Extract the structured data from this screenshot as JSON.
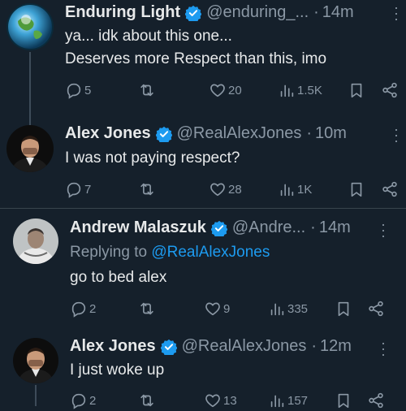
{
  "tweets": [
    {
      "name": "Enduring Light",
      "handle": "@enduring_...",
      "time": "14m",
      "lines": [
        "ya... idk about this one...",
        "Deserves more Respect than this, imo"
      ],
      "replies": "5",
      "retweets": "",
      "likes": "20",
      "views": "1.5K"
    },
    {
      "name": "Alex Jones",
      "handle": "@RealAlexJones",
      "time": "10m",
      "lines": [
        "I was not paying respect?"
      ],
      "replies": "7",
      "retweets": "",
      "likes": "28",
      "views": "1K"
    },
    {
      "name": "Andrew Malaszuk",
      "handle": "@Andre...",
      "time": "14m",
      "replying_prefix": "Replying to",
      "replying_handle": "@RealAlexJones",
      "lines": [
        "go to bed alex"
      ],
      "replies": "2",
      "retweets": "",
      "likes": "9",
      "views": "335"
    },
    {
      "name": "Alex Jones",
      "handle": "@RealAlexJones",
      "time": "12m",
      "lines": [
        "I just woke up"
      ],
      "replies": "2",
      "retweets": "",
      "likes": "13",
      "views": "157"
    }
  ],
  "separator": "·",
  "icons": {
    "reply": "reply-icon",
    "retweet": "retweet-icon",
    "like": "heart-icon",
    "views": "views-icon",
    "bookmark": "bookmark-icon",
    "share": "share-icon",
    "more": "more-icon",
    "verified": "verified-badge-icon"
  },
  "colors": {
    "background": "#15202b",
    "text": "#e7e9ea",
    "muted": "#8b98a5",
    "accent": "#1d9bf0",
    "divider": "#38444d"
  }
}
